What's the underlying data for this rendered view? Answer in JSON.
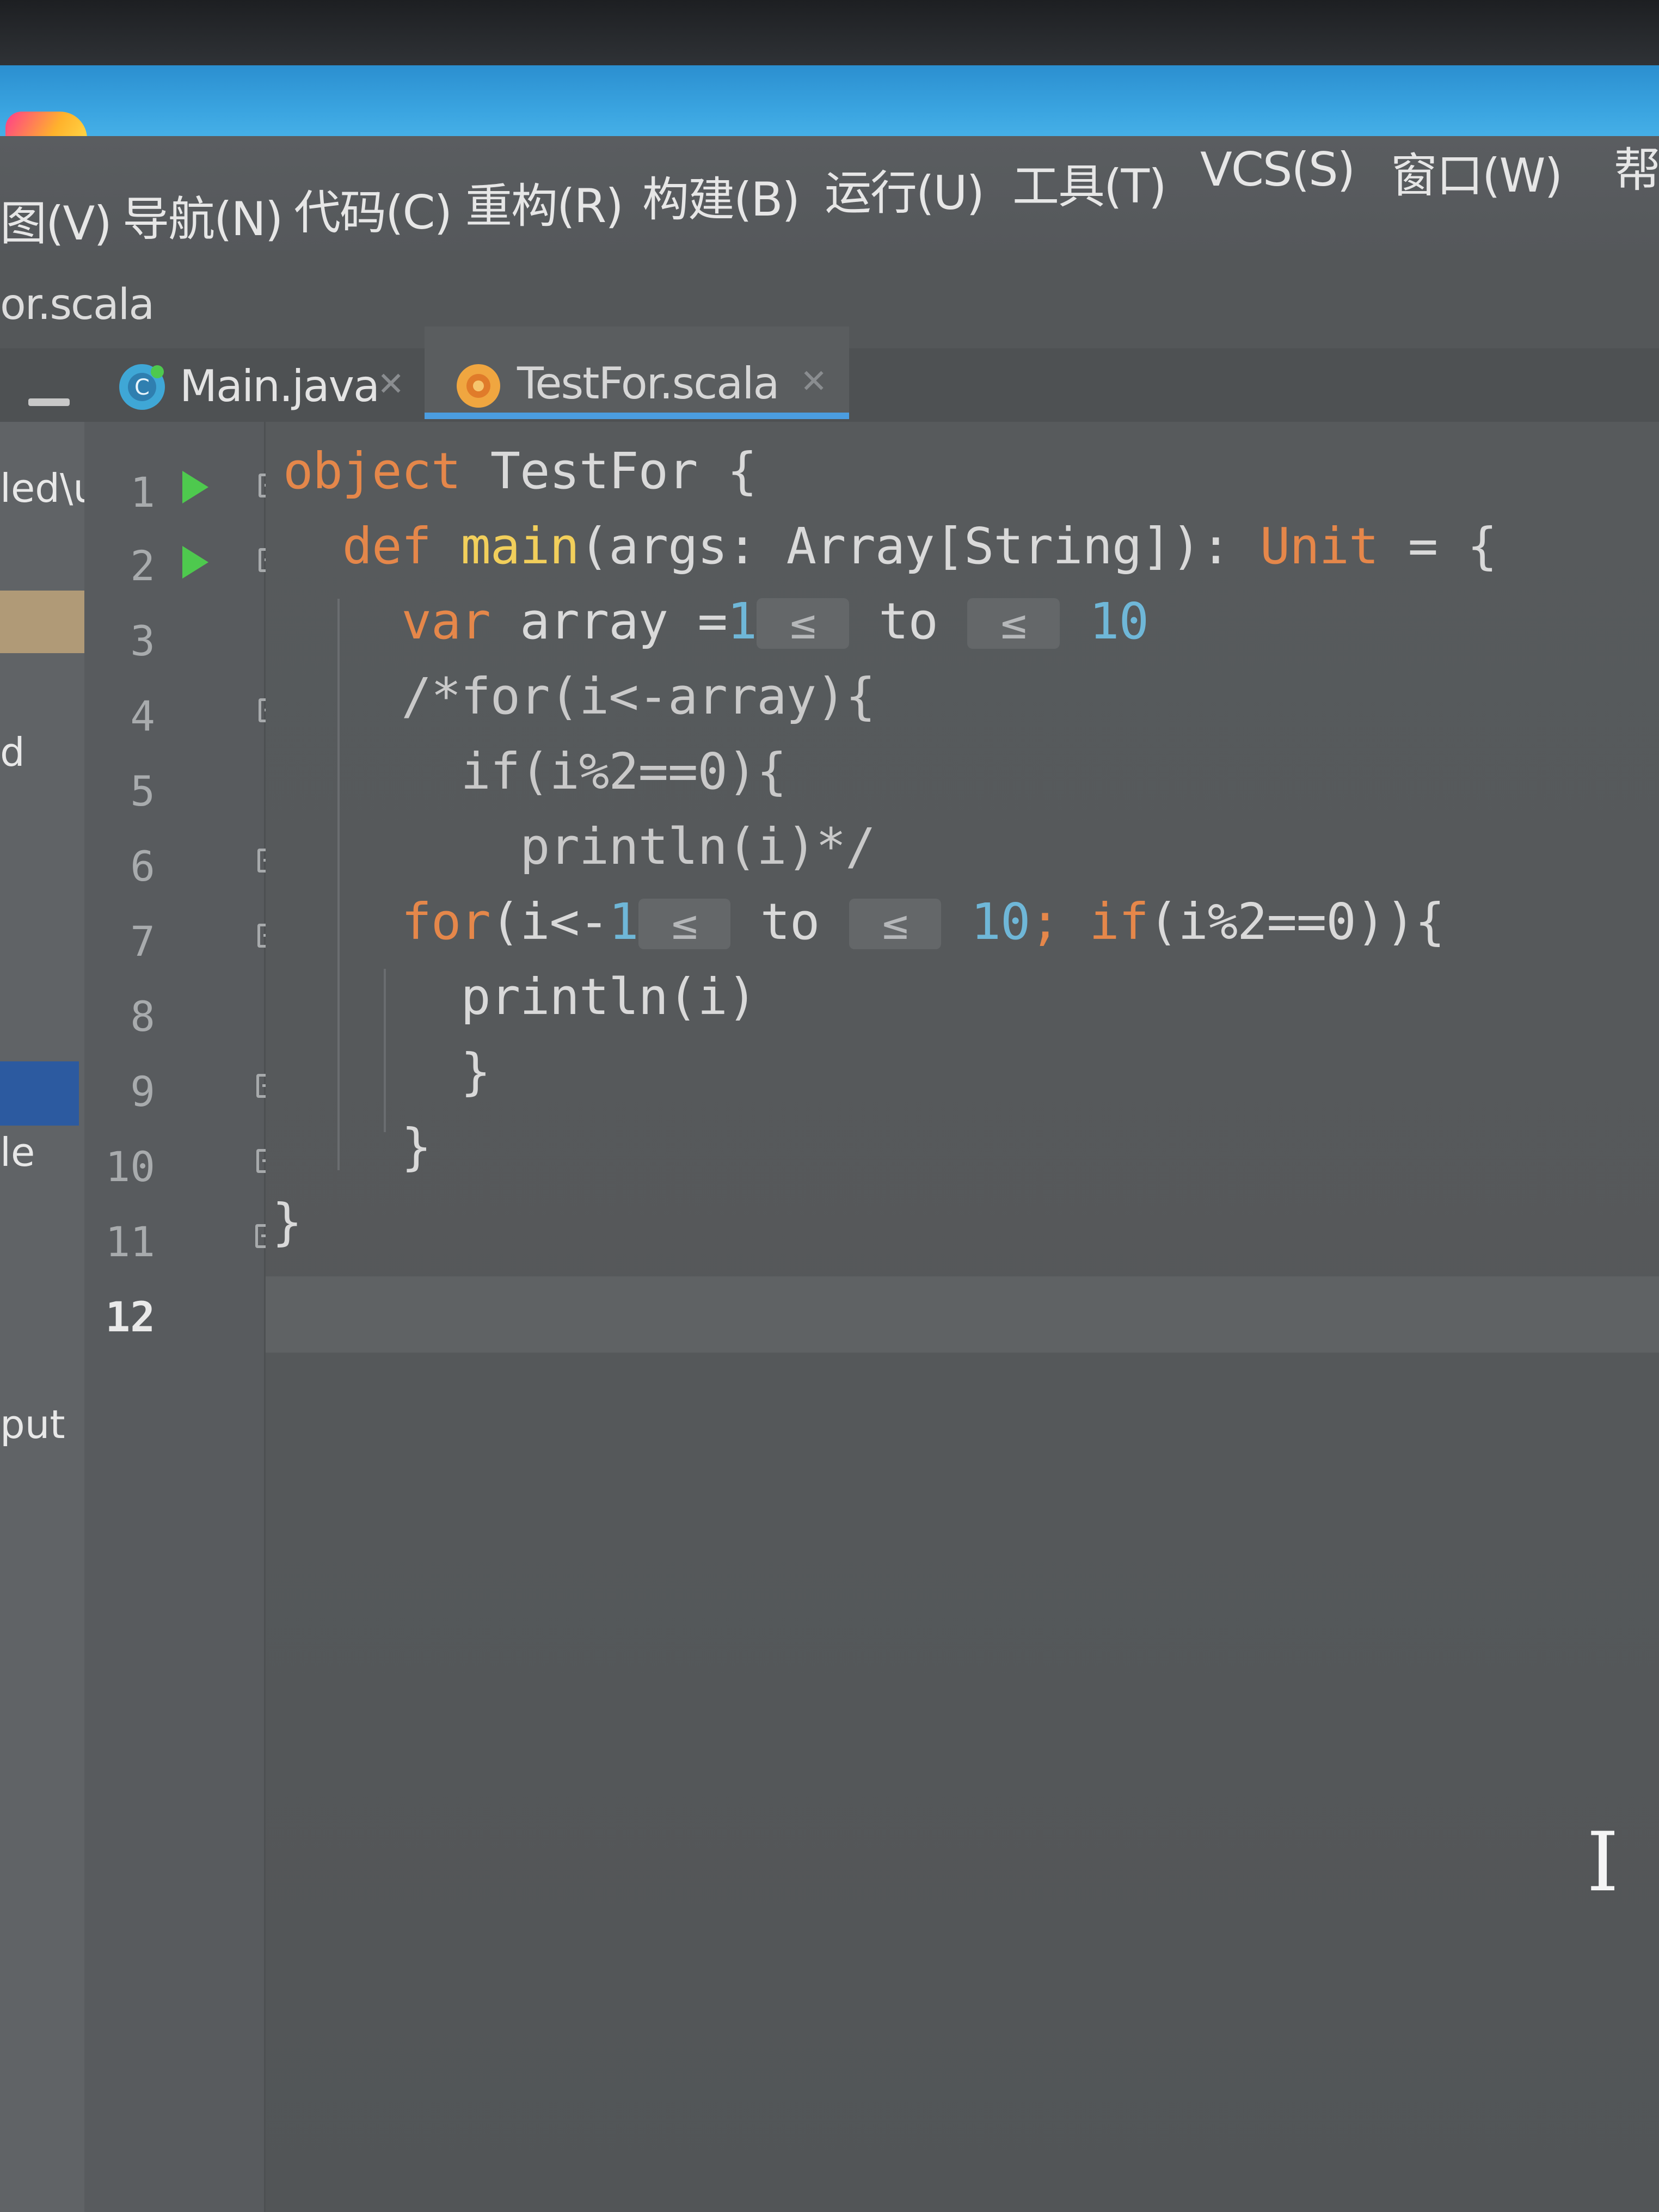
{
  "menu": {
    "items": [
      "图(V)",
      "导航(N)",
      "代码(C)",
      "重构(R)",
      "构建(B)",
      "运行(U)",
      "工具(T)",
      "VCS(S)",
      "窗口(W)",
      "帮"
    ]
  },
  "breadcrumb": {
    "file": "or.scala"
  },
  "tabs": [
    {
      "label": "Main.java",
      "icon": "java-class-icon",
      "active": false
    },
    {
      "label": "TestFor.scala",
      "icon": "scala-object-icon",
      "active": true
    }
  ],
  "project_panel": {
    "fragments": [
      "led\\u",
      "d",
      "le",
      "put"
    ]
  },
  "editor": {
    "line_numbers": [
      "1",
      "2",
      "3",
      "4",
      "5",
      "6",
      "7",
      "8",
      "9",
      "10",
      "11",
      "12"
    ],
    "current_line": "12",
    "lines": [
      {
        "tokens": [
          {
            "t": "object",
            "c": "kw"
          },
          {
            "t": " TestFor {",
            "c": ""
          }
        ]
      },
      {
        "tokens": [
          {
            "t": "  def ",
            "c": "kw"
          },
          {
            "t": "main",
            "c": "fn"
          },
          {
            "t": "(args: Array[String]): ",
            "c": ""
          },
          {
            "t": "Unit",
            "c": "kw"
          },
          {
            "t": " = {",
            "c": ""
          }
        ]
      },
      {
        "tokens": [
          {
            "t": "    var ",
            "c": "kw"
          },
          {
            "t": "array =",
            "c": ""
          },
          {
            "t": "1",
            "c": "num"
          },
          {
            "t": " ≤ ",
            "c": "hint"
          },
          {
            "t": " to ",
            "c": ""
          },
          {
            "t": " ≤ ",
            "c": "hint"
          },
          {
            "t": " 10",
            "c": "num"
          }
        ]
      },
      {
        "tokens": [
          {
            "t": "    /*for(i<-array){",
            "c": "cmt"
          }
        ]
      },
      {
        "tokens": [
          {
            "t": "      if(i%2==0){",
            "c": "cmt"
          }
        ]
      },
      {
        "tokens": [
          {
            "t": "        println(i)*/",
            "c": "cmt"
          }
        ]
      },
      {
        "tokens": [
          {
            "t": "    for",
            "c": "kw"
          },
          {
            "t": "(i<-",
            "c": ""
          },
          {
            "t": "1",
            "c": "num"
          },
          {
            "t": " ≤ ",
            "c": "hint"
          },
          {
            "t": " to ",
            "c": ""
          },
          {
            "t": " ≤ ",
            "c": "hint"
          },
          {
            "t": " 10",
            "c": "num"
          },
          {
            "t": "; ",
            "c": "kw"
          },
          {
            "t": "if",
            "c": "kw"
          },
          {
            "t": "(i%2==0)){",
            "c": ""
          }
        ]
      },
      {
        "tokens": [
          {
            "t": "      println(i)",
            "c": ""
          }
        ]
      },
      {
        "tokens": [
          {
            "t": "      }",
            "c": ""
          }
        ]
      },
      {
        "tokens": [
          {
            "t": "    }",
            "c": ""
          }
        ]
      },
      {
        "tokens": [
          {
            "t": "}",
            "c": ""
          }
        ]
      },
      {
        "tokens": [
          {
            "t": "",
            "c": ""
          }
        ]
      }
    ]
  }
}
